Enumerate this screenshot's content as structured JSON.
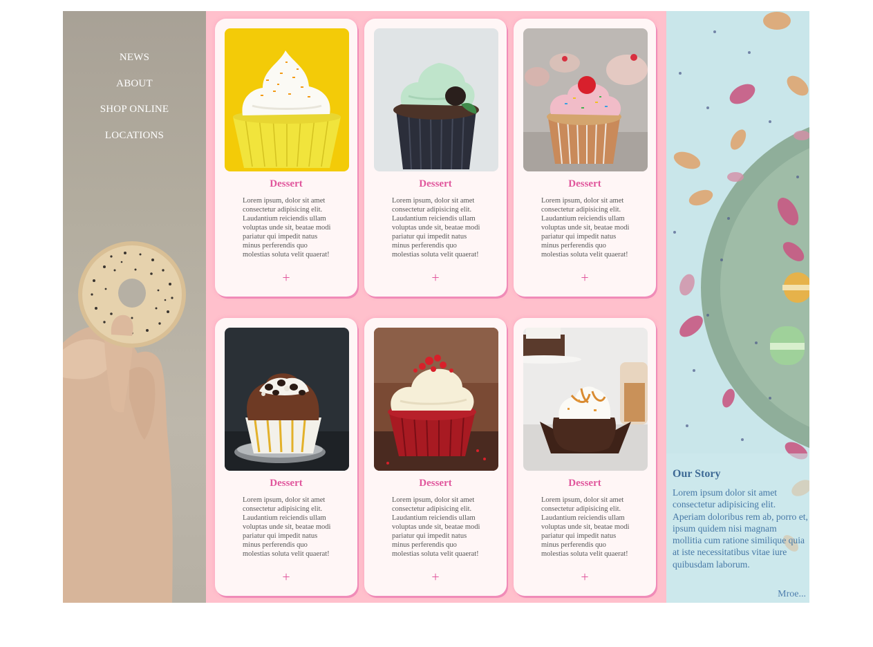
{
  "nav": {
    "items": [
      {
        "label": "NEWS"
      },
      {
        "label": "ABOUT"
      },
      {
        "label": "SHOP ONLINE"
      },
      {
        "label": "LOCATIONS"
      }
    ]
  },
  "cards": [
    {
      "title": "Dessert",
      "text": "Lorem ipsum, dolor sit amet consectetur adipisicing elit. Laudantium reiciendis ullam voluptas unde sit, beatae modi pariatur qui impedit natus minus perferendis quo molestias soluta velit quaerat!",
      "more": "+"
    },
    {
      "title": "Dessert",
      "text": "Lorem ipsum, dolor sit amet consectetur adipisicing elit. Laudantium reiciendis ullam voluptas unde sit, beatae modi pariatur qui impedit natus minus perferendis quo molestias soluta velit quaerat!",
      "more": "+"
    },
    {
      "title": "Dessert",
      "text": "Lorem ipsum, dolor sit amet consectetur adipisicing elit. Laudantium reiciendis ullam voluptas unde sit, beatae modi pariatur qui impedit natus minus perferendis quo molestias soluta velit quaerat!",
      "more": "+"
    },
    {
      "title": "Dessert",
      "text": "Lorem ipsum, dolor sit amet consectetur adipisicing elit. Laudantium reiciendis ullam voluptas unde sit, beatae modi pariatur qui impedit natus minus perferendis quo molestias soluta velit quaerat!",
      "more": "+"
    },
    {
      "title": "Dessert",
      "text": "Lorem ipsum, dolor sit amet consectetur adipisicing elit. Laudantium reiciendis ullam voluptas unde sit, beatae modi pariatur qui impedit natus minus perferendis quo molestias soluta velit quaerat!",
      "more": "+"
    },
    {
      "title": "Dessert",
      "text": "Lorem ipsum, dolor sit amet consectetur adipisicing elit. Laudantium reiciendis ullam voluptas unde sit, beatae modi pariatur qui impedit natus minus perferendis quo molestias soluta velit quaerat!",
      "more": "+"
    }
  ],
  "story": {
    "title": "Our Story",
    "text": "Lorem ipsum dolor sit amet consectetur adipisicing elit. Aperiam doloribus rem ab, porro et, ipsum quidem nisi magnam mollitia cum ratione similique quia at iste necessitatibus vitae iure quibusdam laborum.",
    "more_label": "Mroe..."
  },
  "colors": {
    "grid_background": "#ffc0cc",
    "card_background": "#fff6f6",
    "accent_pink": "#e0569c",
    "story_blue": "#3e6a95",
    "right_panel": "#c9e6ea"
  },
  "images": [
    "cupcake-yellow-photo",
    "cupcake-mint-chocolate-photo",
    "cupcake-pink-cherry-photo",
    "muffin-chocolate-chips-photo",
    "red-velvet-cupcake-photo",
    "caramel-cupcake-photo"
  ]
}
